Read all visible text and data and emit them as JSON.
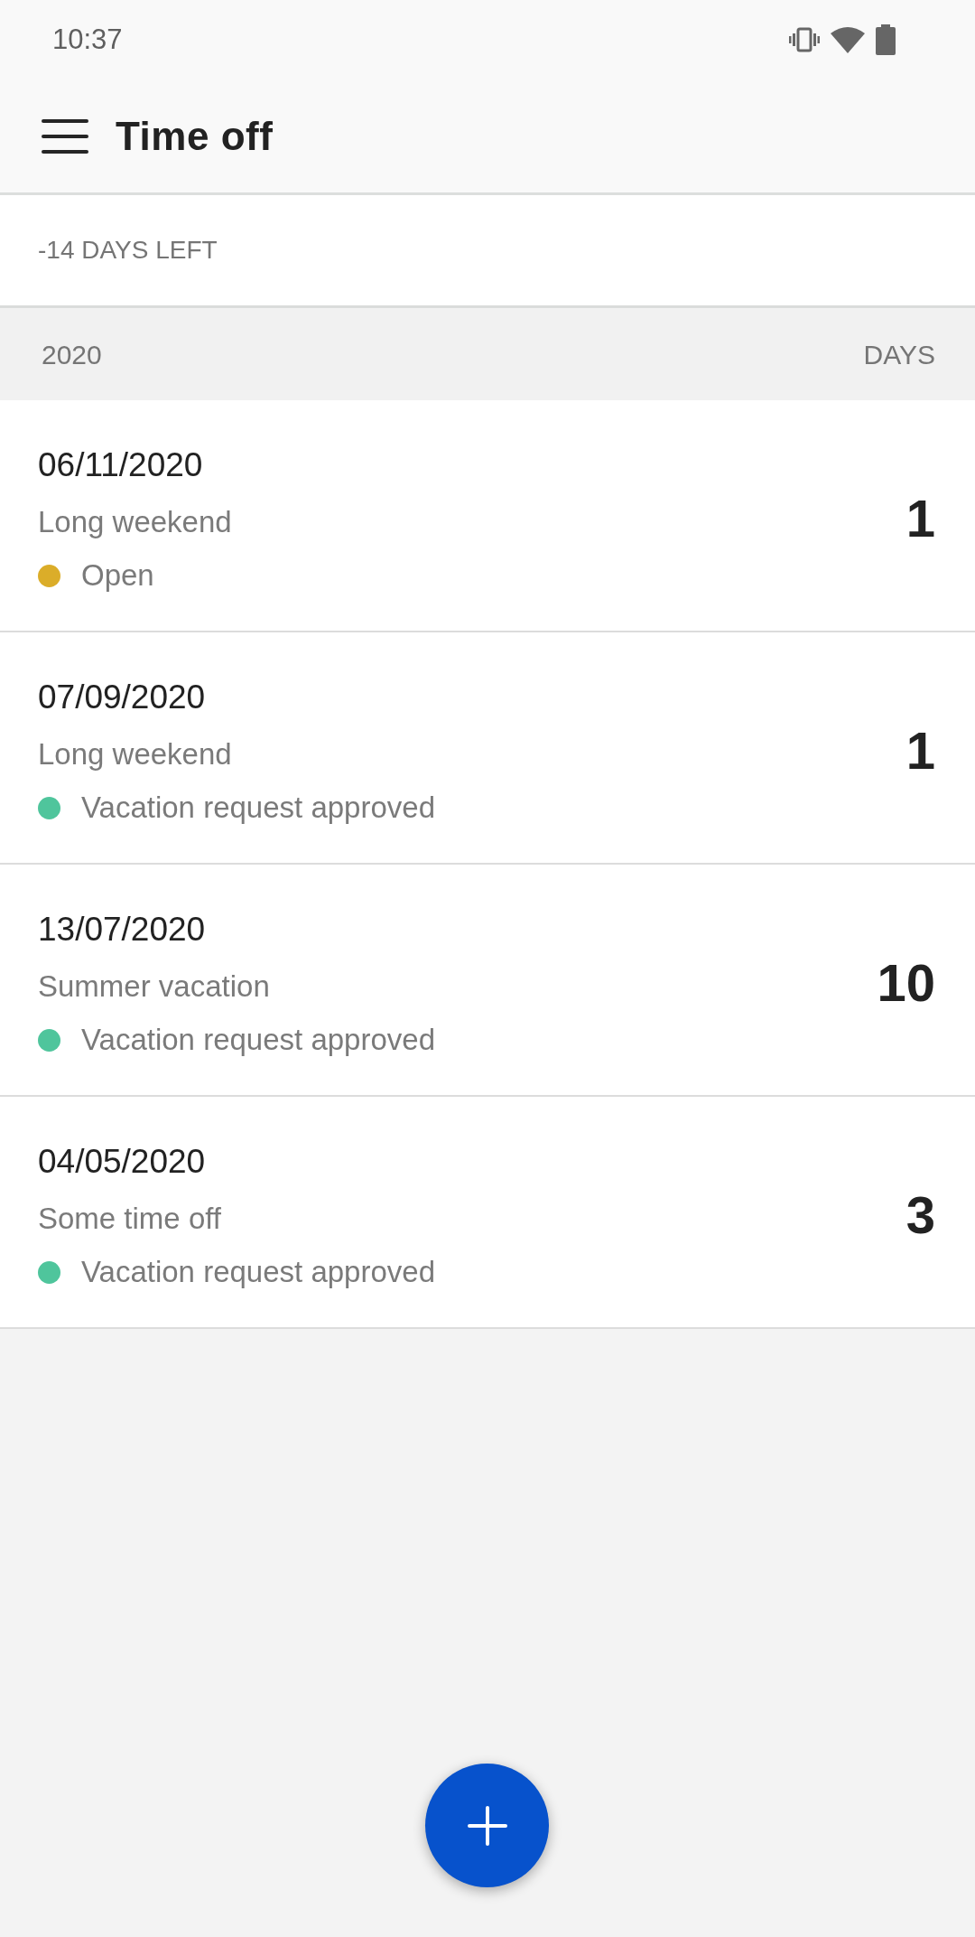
{
  "status_bar": {
    "time": "10:37"
  },
  "app_bar": {
    "title": "Time off"
  },
  "summary": {
    "text": "-14 DAYS LEFT"
  },
  "list_header": {
    "year": "2020",
    "days_label": "DAYS"
  },
  "requests": [
    {
      "date": "06/11/2020",
      "title": "Long weekend",
      "status": "Open",
      "color": "#dbad29",
      "days": "1"
    },
    {
      "date": "07/09/2020",
      "title": "Long weekend",
      "status": "Vacation request approved",
      "color": "#4fc59c",
      "days": "1"
    },
    {
      "date": "13/07/2020",
      "title": "Summer vacation",
      "status": "Vacation request approved",
      "color": "#4fc59c",
      "days": "10"
    },
    {
      "date": "04/05/2020",
      "title": "Some time off",
      "status": "Vacation request approved",
      "color": "#4fc59c",
      "days": "3"
    }
  ]
}
